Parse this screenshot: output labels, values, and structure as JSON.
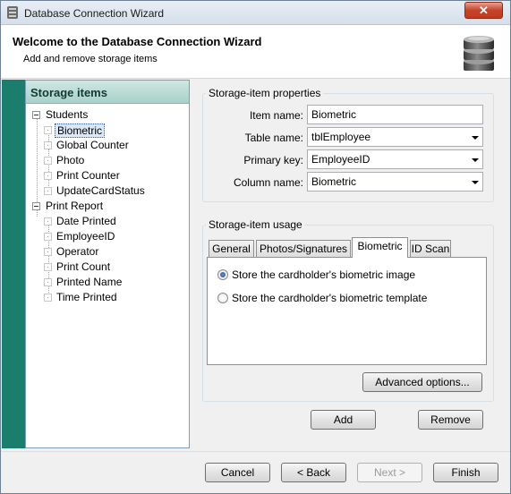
{
  "window": {
    "title": "Database Connection Wizard",
    "close_glyph": "✕"
  },
  "header": {
    "title": "Welcome to the Database Connection Wizard",
    "subtitle": "Add and remove storage items",
    "icon": "database-icon"
  },
  "sidebar": {
    "title": "Storage items",
    "groups": [
      {
        "label": "Students",
        "expanded": true,
        "items": [
          "Biometric",
          "Global Counter",
          "Photo",
          "Print Counter",
          "UpdateCardStatus"
        ],
        "selected_index": 0
      },
      {
        "label": "Print Report",
        "expanded": true,
        "items": [
          "Date Printed",
          "EmployeeID",
          "Operator",
          "Print Count",
          "Printed Name",
          "Time Printed"
        ]
      }
    ]
  },
  "properties": {
    "group_title": "Storage-item properties",
    "item_name_label": "Item name:",
    "item_name_value": "Biometric",
    "table_name_label": "Table name:",
    "table_name_value": "tblEmployee",
    "primary_key_label": "Primary key:",
    "primary_key_value": "EmployeeID",
    "column_name_label": "Column name:",
    "column_name_value": "Biometric"
  },
  "usage": {
    "group_title": "Storage-item usage",
    "tabs": [
      "General",
      "Photos/Signatures",
      "Biometric",
      "ID Scan"
    ],
    "active_tab": "Biometric",
    "options": [
      {
        "label": "Store the cardholder's biometric image",
        "checked": true
      },
      {
        "label": "Store the cardholder's biometric template",
        "checked": false
      }
    ],
    "advanced_label": "Advanced options..."
  },
  "actions": {
    "add_label": "Add",
    "remove_label": "Remove"
  },
  "footer": {
    "cancel_label": "Cancel",
    "back_label": "< Back",
    "next_label": "Next >",
    "finish_label": "Finish"
  }
}
